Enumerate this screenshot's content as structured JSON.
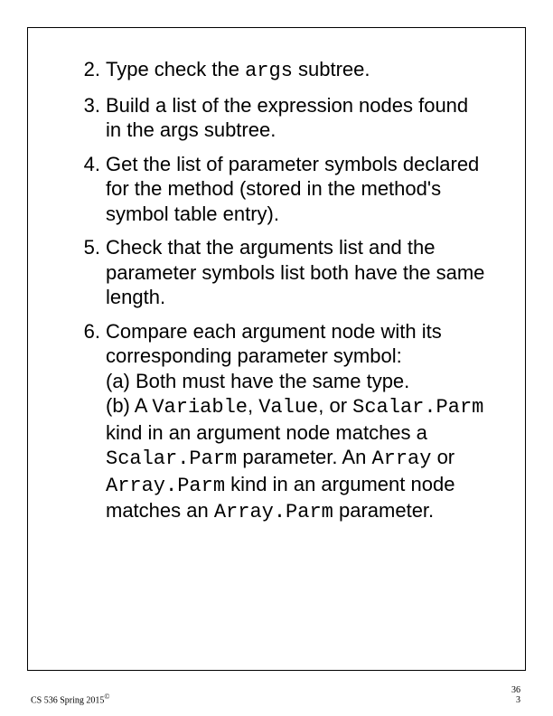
{
  "items": [
    {
      "num": "2.",
      "html": "Type check the <span class=\"mono\">args</span> subtree."
    },
    {
      "num": "3.",
      "html": "Build a list of the expression nodes found in the args subtree."
    },
    {
      "num": "4.",
      "html": "Get the list of parameter symbols declared for the method (stored in the method's symbol table entry)."
    },
    {
      "num": "5.",
      "html": "Check that the arguments list and the parameter symbols list both have the same length."
    },
    {
      "num": "6.",
      "html": "Compare each argument node with its corresponding parameter symbol:<br>(a) Both must have the same type.<br>(b) A <span class=\"mono\">Variable</span>, <span class=\"mono\">Value</span>, or <span class=\"mono\">Scalar.Parm</span> kind in an argument node matches a <span class=\"mono\">Scalar.Parm</span> parameter. An <span class=\"mono\">Array</span> or <span class=\"mono\">Array.Parm</span> kind in an argument node matches an <span class=\"mono\">Array.Parm</span> parameter."
    }
  ],
  "footer": {
    "left": "CS 536  Spring 2015",
    "copyright": "©",
    "pageTop": "36",
    "pageBottom": "3"
  }
}
